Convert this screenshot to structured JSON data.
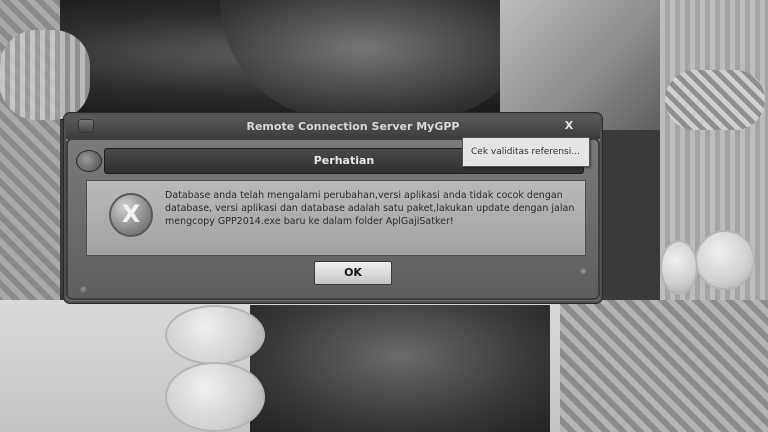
{
  "outer_window": {
    "title": "Remote Connection Server MyGPP",
    "close_label": "X"
  },
  "dialog": {
    "title": "Perhatian",
    "icon": "error-x-icon",
    "icon_glyph": "X",
    "message": "Database anda telah mengalami perubahan,versi aplikasi anda tidak cocok dengan database, versi aplikasi dan database adalah satu paket,lakukan update dengan jalan mengcopy GPP2014.exe baru ke dalam folder AplGajiSatker!",
    "ok_label": "OK"
  },
  "tooltip": {
    "text": "Cek validitas referensi..."
  }
}
